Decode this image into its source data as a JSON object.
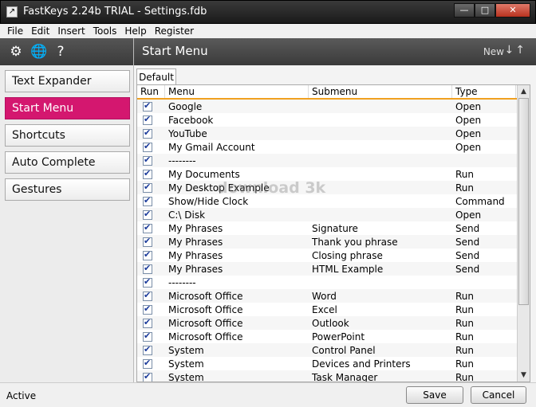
{
  "window": {
    "title": "FastKeys 2.24b TRIAL - Settings.fdb"
  },
  "menubar": [
    "File",
    "Edit",
    "Insert",
    "Tools",
    "Help",
    "Register"
  ],
  "sidebar": {
    "items": [
      {
        "label": "Text Expander",
        "active": false
      },
      {
        "label": "Start Menu",
        "active": true
      },
      {
        "label": "Shortcuts",
        "active": false
      },
      {
        "label": "Auto Complete",
        "active": false
      },
      {
        "label": "Gestures",
        "active": false
      }
    ]
  },
  "content": {
    "title": "Start Menu",
    "new_label": "New",
    "tab": "Default",
    "columns": [
      "Run",
      "Menu",
      "Submenu",
      "Type"
    ],
    "rows": [
      {
        "menu": "Google",
        "submenu": "",
        "type": "Open"
      },
      {
        "menu": "Facebook",
        "submenu": "",
        "type": "Open"
      },
      {
        "menu": "YouTube",
        "submenu": "",
        "type": "Open"
      },
      {
        "menu": "My Gmail Account",
        "submenu": "",
        "type": "Open"
      },
      {
        "menu": "--------",
        "submenu": "",
        "type": ""
      },
      {
        "menu": "My Documents",
        "submenu": "",
        "type": "Run"
      },
      {
        "menu": "My Desktop Example",
        "submenu": "",
        "type": "Run"
      },
      {
        "menu": "Show/Hide Clock",
        "submenu": "",
        "type": "Command"
      },
      {
        "menu": "C:\\ Disk",
        "submenu": "",
        "type": "Open"
      },
      {
        "menu": "My Phrases",
        "submenu": "Signature",
        "type": "Send"
      },
      {
        "menu": "My Phrases",
        "submenu": "Thank you phrase",
        "type": "Send"
      },
      {
        "menu": "My Phrases",
        "submenu": "Closing phrase",
        "type": "Send"
      },
      {
        "menu": "My Phrases",
        "submenu": "HTML Example",
        "type": "Send"
      },
      {
        "menu": "--------",
        "submenu": "",
        "type": ""
      },
      {
        "menu": "Microsoft Office",
        "submenu": "Word",
        "type": "Run"
      },
      {
        "menu": "Microsoft Office",
        "submenu": "Excel",
        "type": "Run"
      },
      {
        "menu": "Microsoft Office",
        "submenu": "Outlook",
        "type": "Run"
      },
      {
        "menu": "Microsoft Office",
        "submenu": "PowerPoint",
        "type": "Run"
      },
      {
        "menu": "System",
        "submenu": "Control Panel",
        "type": "Run"
      },
      {
        "menu": "System",
        "submenu": "Devices and Printers",
        "type": "Run"
      },
      {
        "menu": "System",
        "submenu": "Task Manager",
        "type": "Run"
      }
    ]
  },
  "watermark": "download 3k",
  "statusbar": {
    "status": "Active",
    "save": "Save",
    "cancel": "Cancel"
  }
}
